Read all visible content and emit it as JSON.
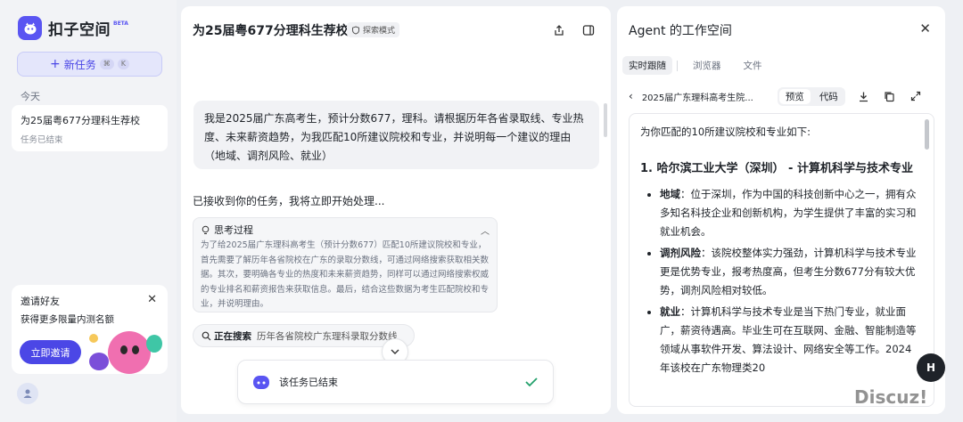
{
  "sidebar": {
    "brand": "扣子空间",
    "beta": "BETA",
    "new_task_label": "新任务",
    "new_task_shortcut_1": "⌘",
    "new_task_shortcut_2": "K",
    "section_today": "今天",
    "task": {
      "title": "为25届粤677分理科生荐校",
      "status": "任务已结束"
    },
    "invite": {
      "line1": "邀请好友",
      "line2": "获得更多限量内测名额",
      "button": "立即邀请"
    }
  },
  "chat": {
    "title": "为25届粤677分理科生荐校",
    "mode_tag": "探索模式",
    "user_message": "我是2025届广东高考生，预计分数677，理科。请根据历年各省录取线、专业热度、未来薪资趋势，为我匹配10所建议院校和专业，并说明每一个建议的理由（地域、调剂风险、就业）",
    "received": "已接收到你的任务，我将立即开始处理...",
    "thinking": {
      "label": "思考过程",
      "body": "为了给2025届广东理科高考生（预计分数677）匹配10所建议院校和专业，首先需要了解历年各省院校在广东的录取分数线，可通过网络搜索获取相关数据。其次，要明确各专业的热度和未来薪资趋势，同样可以通过网络搜索权威的专业排名和薪资报告来获取信息。最后，结合这些数据为考生匹配院校和专业，并说明理由。"
    },
    "searching": {
      "label": "正在搜索",
      "query": "历年各省院校广东理科录取分数线"
    },
    "ended": "该任务已结束"
  },
  "agent": {
    "title": "Agent 的工作空间",
    "tabs": [
      "实时跟随",
      "浏览器",
      "文件"
    ],
    "file_name": "2025届广东理科高考生院...",
    "view_modes": [
      "预览",
      "代码"
    ],
    "doc": {
      "intro": "为你匹配的10所建议院校和专业如下:",
      "heading": "1. 哈尔滨工业大学（深圳） - 计算机科学与技术专业",
      "items": [
        {
          "key": "地域",
          "text": "：位于深圳，作为中国的科技创新中心之一，拥有众多知名科技企业和创新机构，为学生提供了丰富的实习和就业机会。"
        },
        {
          "key": "调剂风险",
          "text": "：该院校整体实力强劲，计算机科学与技术专业更是优势专业，报考热度高，但考生分数677分有较大优势，调剂风险相对较低。"
        },
        {
          "key": "就业",
          "text": "：计算机科学与技术专业是当下热门专业，就业面广，薪资待遇高。毕业生可在互联网、金融、智能制造等领域从事软件开发、算法设计、网络安全等工作。2024年该校在广东物理类20"
        }
      ]
    }
  },
  "fab_label": "H",
  "watermark": "Discuz!",
  "colors": {
    "accent": "#4b47e6",
    "success": "#22a06b"
  }
}
